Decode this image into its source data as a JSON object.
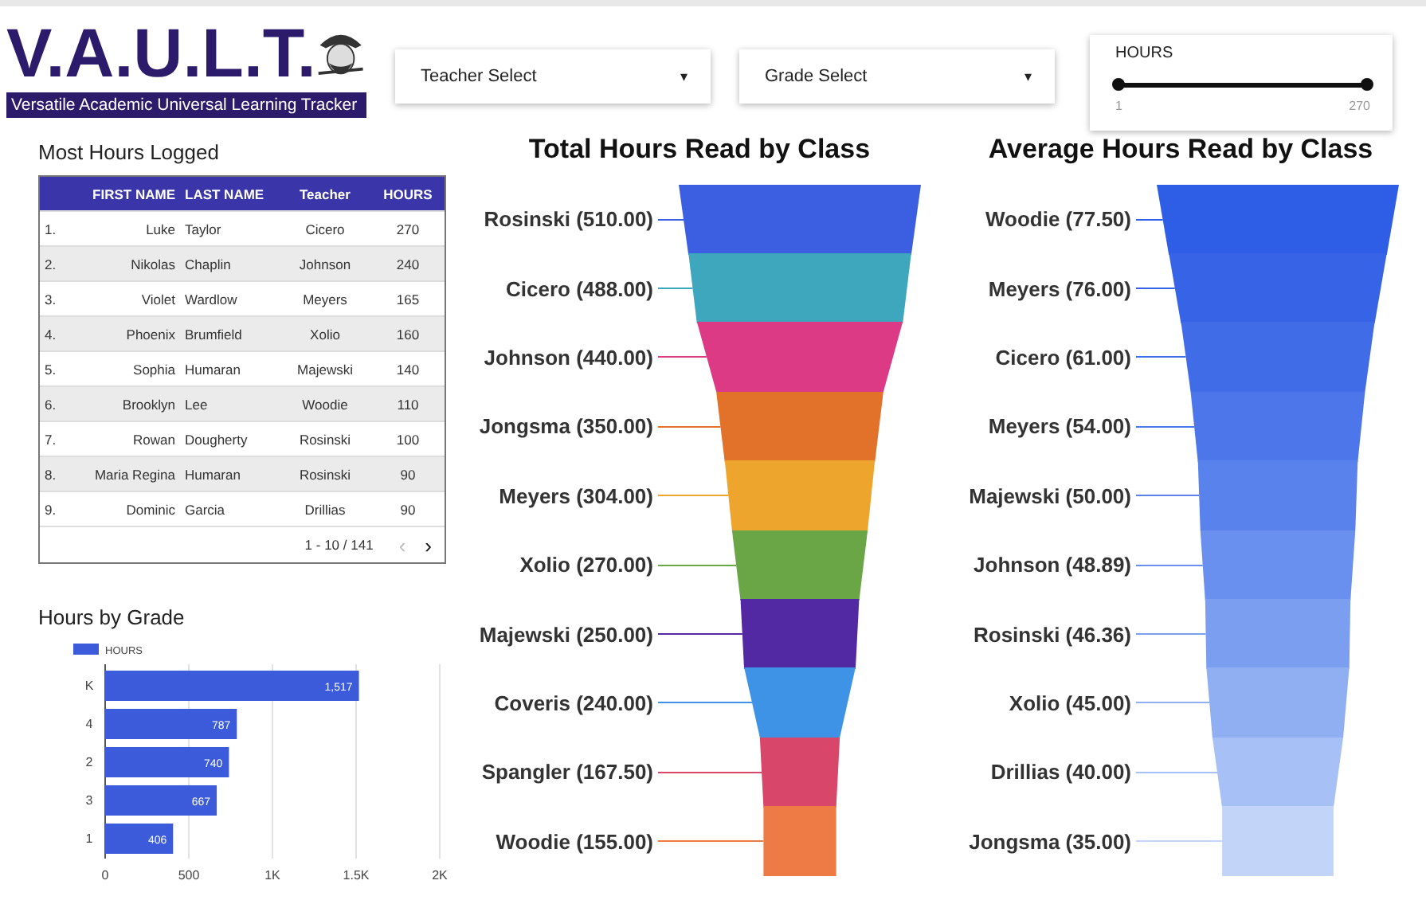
{
  "header": {
    "logo_title": "V.A.U.L.T.",
    "logo_subtitle": "Versatile Academic Universal Learning Tracker"
  },
  "filters": [
    {
      "label": "Teacher Select",
      "caret": "▾"
    },
    {
      "label": "Grade Select",
      "caret": "▾"
    }
  ],
  "hours_slider": {
    "label": "HOURS",
    "min": "1",
    "max": "270",
    "level": 1
  },
  "most_hours": {
    "title": "Most Hours Logged",
    "columns": [
      "",
      "FIRST NAME",
      "LAST NAME",
      "Teacher",
      "HOURS"
    ],
    "rows": [
      [
        "1.",
        "Luke",
        "Taylor",
        "Cicero",
        "270"
      ],
      [
        "2.",
        "Nikolas",
        "Chaplin",
        "Johnson",
        "240"
      ],
      [
        "3.",
        "Violet",
        "Wardlow",
        "Meyers",
        "165"
      ],
      [
        "4.",
        "Phoenix",
        "Brumfield",
        "Xolio",
        "160"
      ],
      [
        "5.",
        "Sophia",
        "Humaran",
        "Majewski",
        "140"
      ],
      [
        "6.",
        "Brooklyn",
        "Lee",
        "Woodie",
        "110"
      ],
      [
        "7.",
        "Rowan",
        "Dougherty",
        "Rosinski",
        "100"
      ],
      [
        "8.",
        "Maria Regina",
        "Humaran",
        "Rosinski",
        "90"
      ],
      [
        "9.",
        "Dominic",
        "Garcia",
        "Drillias",
        "90"
      ]
    ],
    "pagination": "1 - 10 / 141",
    "prev": "‹",
    "next": "›"
  },
  "hours_by_grade": {
    "title": "Hours by Grade",
    "chart_data": {
      "type": "bar",
      "orientation": "horizontal",
      "categories": [
        "K",
        "4",
        "2",
        "3",
        "1"
      ],
      "series": [
        {
          "name": "HOURS",
          "color": "#3b5bdb",
          "values": [
            1517,
            787,
            740,
            667,
            406
          ]
        }
      ],
      "xlim": [
        0,
        2000
      ],
      "grid": true,
      "xticks": [
        0,
        500,
        {
          "value": 1000,
          "label": "1K"
        },
        {
          "value": 1500,
          "label": "1.5K"
        },
        {
          "value": 2000,
          "label": "2K"
        }
      ],
      "value_labels": [
        "1,517",
        "787",
        "740",
        "667",
        "406"
      ]
    }
  },
  "total_hours": {
    "title": "Total Hours Read by Class",
    "stages": [
      {
        "label": "Rosinski (510.00)",
        "color": "#3b5fe0"
      },
      {
        "label": "Cicero (488.00)",
        "color": "#3fa7bd"
      },
      {
        "label": "Johnson (440.00)",
        "color": "#dd3a86"
      },
      {
        "label": "Jongsma (350.00)",
        "color": "#e2712a"
      },
      {
        "label": "Meyers (304.00)",
        "color": "#eea52e"
      },
      {
        "label": "Xolio (270.00)",
        "color": "#6aa546"
      },
      {
        "label": "Majewski (250.00)",
        "color": "#5328a3"
      },
      {
        "label": "Coveris (240.00)",
        "color": "#3f93e6"
      },
      {
        "label": "Spangler (167.50)",
        "color": "#d8466a"
      },
      {
        "label": "Woodie (155.00)",
        "color": "#ee7a45"
      }
    ]
  },
  "average_hours": {
    "title": "Average Hours Read by Class",
    "stages": [
      {
        "label": "Woodie (77.50)",
        "color": "#2f5ee6"
      },
      {
        "label": "Meyers (76.00)",
        "color": "#3764e6"
      },
      {
        "label": "Cicero (61.00)",
        "color": "#416ce8"
      },
      {
        "label": "Meyers (54.00)",
        "color": "#4c76ea"
      },
      {
        "label": "Majewski (50.00)",
        "color": "#5a82ec"
      },
      {
        "label": "Johnson (48.89)",
        "color": "#6990ee"
      },
      {
        "label": "Rosinski (46.36)",
        "color": "#7b9ef1"
      },
      {
        "label": "Xolio (45.00)",
        "color": "#90aff3"
      },
      {
        "label": "Drillias (40.00)",
        "color": "#a7c0f6"
      },
      {
        "label": "Jongsma (35.00)",
        "color": "#c3d4f9"
      }
    ]
  }
}
